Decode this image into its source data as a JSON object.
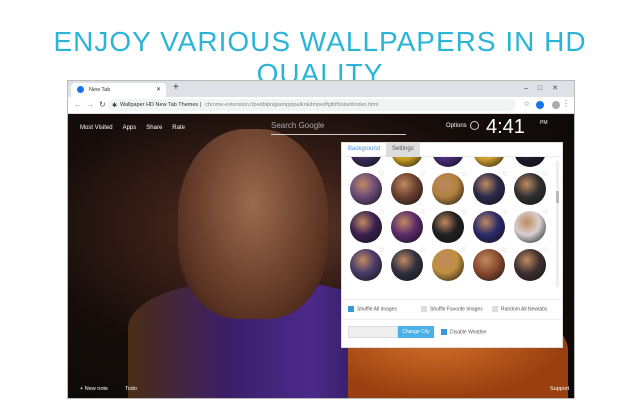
{
  "banner": {
    "title": "ENJOY VARIOUS WALLPAPERS IN HD QUALITY"
  },
  "browser": {
    "tab_title": "New Tab",
    "new_tab": "+",
    "page_title": "Wallpaper HD New Tab Themes",
    "url": "chrome-extension://pedblpnigiamppipalknkdmpedfglbfh/start/index.html"
  },
  "page": {
    "top_links": [
      "Most Visited",
      "Apps",
      "Share",
      "Rate"
    ],
    "search_placeholder": "Search Google",
    "options": "Options",
    "time": "4:41",
    "ampm": "PM",
    "panel": {
      "tabs": [
        "Background",
        "Settings"
      ],
      "checkboxes": [
        {
          "label": "Shuffle All Images",
          "checked": true
        },
        {
          "label": "Shuffle Favorite Images",
          "checked": false
        },
        {
          "label": "Random All Newtabs",
          "checked": false
        }
      ],
      "change_city": "Change City",
      "disable_weather": "Disable Weather",
      "disable_weather_checked": true
    },
    "new_note": "+ New note",
    "todo": "Todo",
    "support": "Support"
  },
  "thumb_colors": [
    "#3a2a5a",
    "#c9a020",
    "#4a2a7a",
    "#d0a030",
    "#1a1a2a",
    "#6a4a7a",
    "#6a4030",
    "#b08040",
    "#2a2a4a",
    "#303030",
    "#3a2050",
    "#5a2a6a",
    "#202020",
    "#2a2a6a",
    "#d8d0d0",
    "#4a3a6a",
    "#303040",
    "#c09040",
    "#8a4a30",
    "#403030"
  ],
  "colors": {
    "accent": "#2bb4d8",
    "button": "#4ab0e8"
  }
}
